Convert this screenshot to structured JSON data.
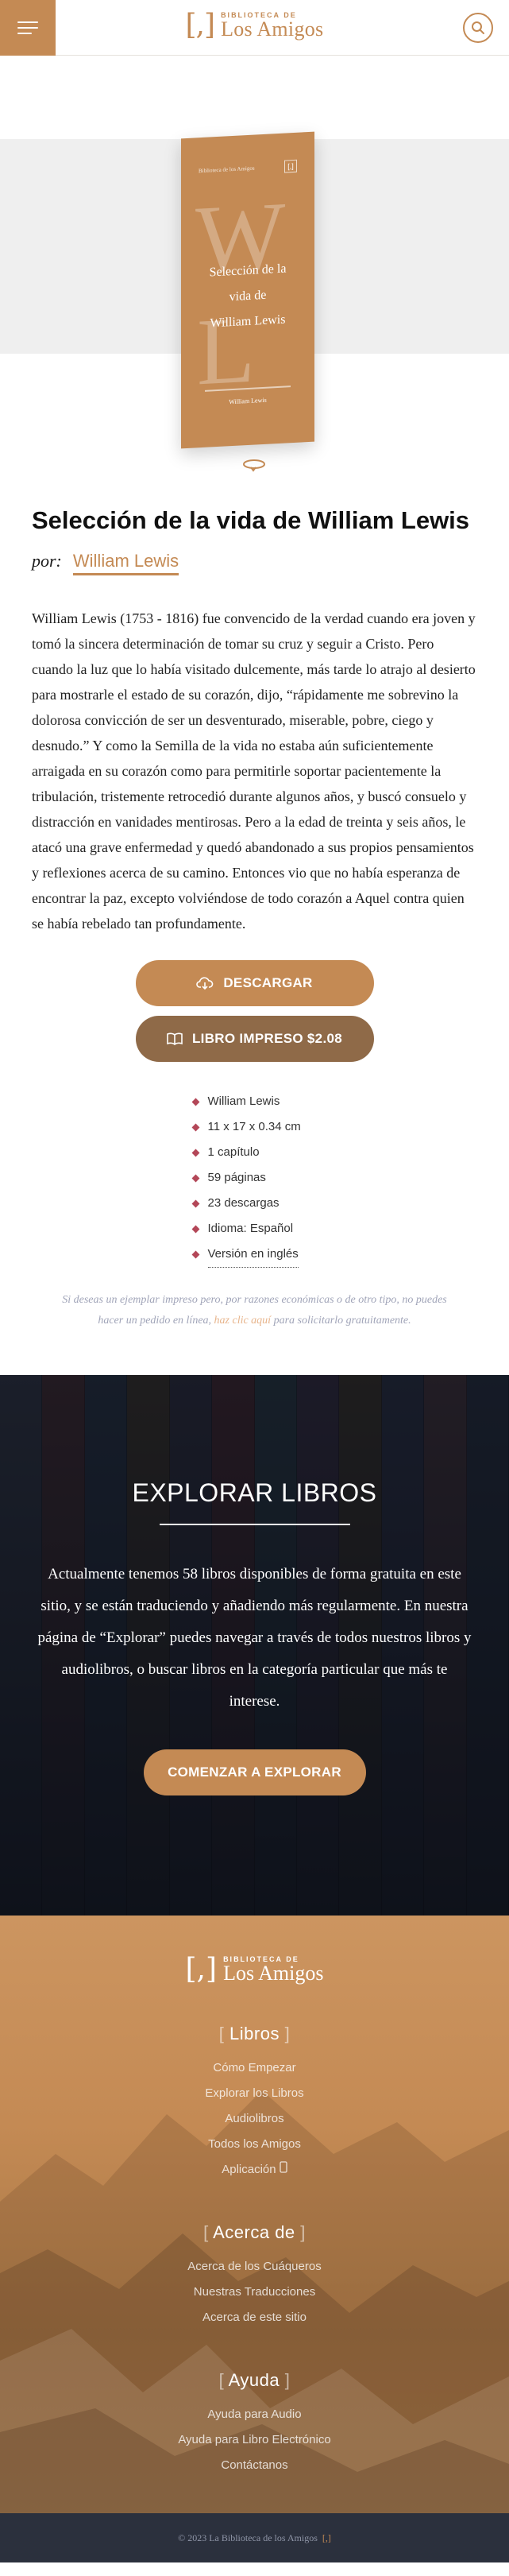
{
  "header": {
    "logo_top": "BIBLIOTECA DE",
    "logo_bottom": "Los Amigos",
    "logo_mark": "[,]",
    "menu_icon": "hamburger-icon",
    "search_icon": "search-icon"
  },
  "cover": {
    "brand": "Biblioteca de los Amigos",
    "title_line1": "Selección de la",
    "title_line2": "vida de",
    "title_line3": "William Lewis",
    "author": "William Lewis",
    "letters_top": "W",
    "letters_bottom": "L"
  },
  "book": {
    "title": "Selección de la vida de William Lewis",
    "by_label": "por:",
    "author": "William Lewis",
    "description": "William Lewis (1753 - 1816) fue convencido de la verdad cuando era joven y tomó la sincera determinación de tomar su cruz y seguir a Cristo. Pero cuando la luz que lo había visitado dulcemente, más tarde lo atrajo al desierto para mostrarle el estado de su corazón, dijo, “rápidamente me sobrevino la dolorosa convicción de ser un desventurado, miserable, pobre, ciego y desnudo.” Y como la Semilla de la vida no estaba aún suficientemente arraigada en su corazón como para permitirle soportar pacientemente la tribulación, tristemente retrocedió durante algunos años, y buscó consuelo y distracción en vanidades mentirosas. Pero a la edad de treinta y seis años, le atacó una grave enfermedad y quedó abandonado a sus propios pensamientos y reflexiones acerca de su camino. Entonces vio que no había esperanza de encontrar la paz, excepto volviéndose de todo corazón a Aquel contra quien se había rebelado tan profundamente."
  },
  "buttons": {
    "download": "DESCARGAR",
    "print": "LIBRO IMPRESO $2.08"
  },
  "meta": [
    "William Lewis",
    "11 x 17 x 0.34 cm",
    "1 capítulo",
    "59 páginas",
    "23 descargas",
    "Idioma: Español",
    "Versión en inglés"
  ],
  "note": {
    "before": "Si deseas un ejemplar impreso pero, por razones económicas o de otro tipo, no puedes hacer un pedido en línea, ",
    "link": "haz clic aquí",
    "after": " para solicitarlo gratuitamente."
  },
  "explore": {
    "title": "EXPLORAR LIBROS",
    "text": "Actualmente tenemos 58 libros disponibles de forma gratuita en este sitio, y se están traduciendo y añadiendo más regularmente. En nuestra página de “Explorar” puedes navegar a través de todos nuestros libros y audiolibros, o buscar libros en la categoría particular que más te interese.",
    "button": "COMENZAR A EXPLORAR"
  },
  "footer": {
    "logo_top": "BIBLIOTECA DE",
    "logo_bottom": "Los Amigos",
    "logo_mark": "[,]",
    "sections": [
      {
        "heading": "Libros",
        "items": [
          "Cómo Empezar",
          "Explorar los Libros",
          "Audiolibros",
          "Todos los Amigos",
          "Aplicación"
        ]
      },
      {
        "heading": "Acerca de",
        "items": [
          "Acerca de los Cuáqueros",
          "Nuestras Traducciones",
          "Acerca de este sitio"
        ]
      },
      {
        "heading": "Ayuda",
        "items": [
          "Ayuda para Audio",
          "Ayuda para Libro Electrónico",
          "Contáctanos"
        ]
      }
    ],
    "copyright": "© 2023 La Biblioteca de los Amigos",
    "copyright_mark": "[,]"
  },
  "colors": {
    "accent": "#c48a54",
    "accent_dark": "#8f6a48",
    "bullet": "#b34758",
    "dark_bg": "#151922",
    "copyright_bg": "#2b303d"
  }
}
